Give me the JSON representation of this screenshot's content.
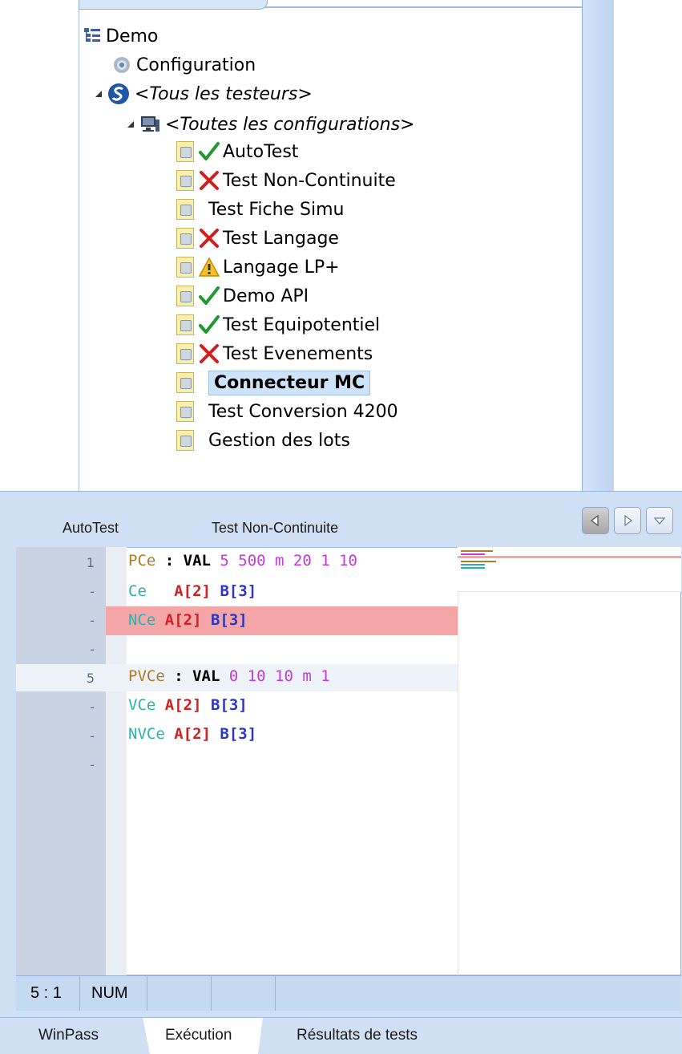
{
  "tree": {
    "root": {
      "label": "Demo",
      "icon": "tree-icon"
    },
    "configuration": {
      "label": "Configuration",
      "icon": "gear-icon"
    },
    "testers": {
      "label": "<Tous les testeurs>",
      "icon": "s-logo-icon"
    },
    "configurations": {
      "label": "<Toutes les configurations>",
      "icon": "computer-icon"
    },
    "items": [
      {
        "label": "AutoTest",
        "status": "pass"
      },
      {
        "label": "Test Non-Continuite",
        "status": "fail"
      },
      {
        "label": "Test Fiche Simu",
        "status": "none"
      },
      {
        "label": "Test Langage",
        "status": "fail"
      },
      {
        "label": "Langage LP+",
        "status": "warning"
      },
      {
        "label": "Demo API",
        "status": "pass"
      },
      {
        "label": "Test Equipotentiel",
        "status": "pass"
      },
      {
        "label": "Test Evenements",
        "status": "fail"
      },
      {
        "label": "Connecteur MC",
        "status": "none",
        "selected": true
      },
      {
        "label": "Test Conversion 4200",
        "status": "none"
      },
      {
        "label": "Gestion des lots",
        "status": "none"
      }
    ]
  },
  "editor": {
    "tabs": [
      "AutoTest",
      "Test Non-Continuite"
    ],
    "gutter": [
      "1",
      "-",
      "-",
      "-",
      "5",
      "-",
      "-",
      "-"
    ],
    "lines": [
      {
        "name": "PCe",
        "op": " : VAL ",
        "values": "5 500 m 20 1 10"
      },
      {
        "name": "Ce  ",
        "a": "A[2]",
        "b": "B[3]"
      },
      {
        "name": "NCe ",
        "a": "A[2]",
        "b": "B[3]"
      },
      {},
      {
        "name": "PVCe",
        "op": " : VAL ",
        "values": "0 10 10 m 1"
      },
      {
        "name": "VCe ",
        "a": "A[2]",
        "b": "B[3]"
      },
      {
        "name": "NVCe ",
        "a": "A[2]",
        "b": "B[3]"
      }
    ],
    "status": {
      "position": "5 : 1",
      "num": "NUM"
    }
  },
  "bottom_tabs": [
    "WinPass",
    "Exécution",
    "Résultats de tests"
  ],
  "colors": {
    "accent": "#cfe0f5",
    "error_highlight": "#f4a6a6",
    "selection": "#cde3f9"
  }
}
